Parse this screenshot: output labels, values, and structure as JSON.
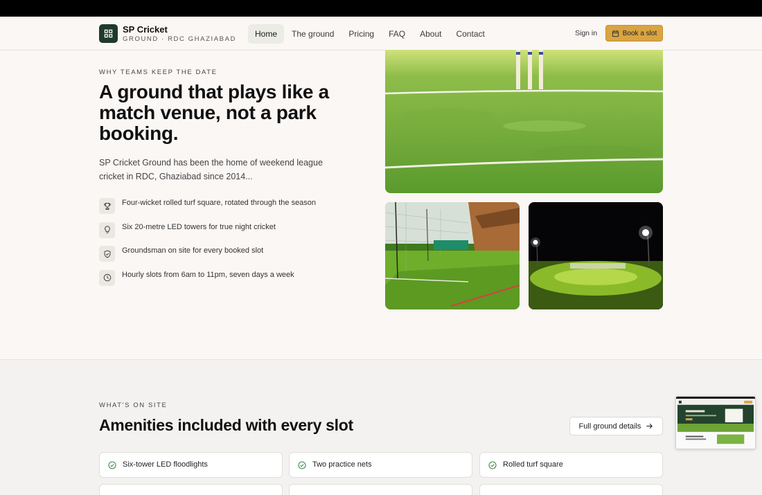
{
  "brand": {
    "name": "SP Cricket",
    "tagline": "GROUND · RDC GHAZIABAD"
  },
  "nav": {
    "links": [
      "Home",
      "The ground",
      "Pricing",
      "FAQ",
      "About",
      "Contact"
    ],
    "active": "Home",
    "signin": "Sign in",
    "book": "Book a slot"
  },
  "hero": {
    "eyebrow": "WHY TEAMS KEEP THE DATE",
    "title": "A ground that plays like a match venue, not a park booking.",
    "text": "SP Cricket Ground has been the home of weekend league cricket in RDC, Ghaziabad since 2014...",
    "features": [
      {
        "icon": "trophy-icon",
        "text": "Four-wicket rolled turf square, rotated through the season"
      },
      {
        "icon": "lightbulb-icon",
        "text": "Six 20-metre LED towers for true night cricket"
      },
      {
        "icon": "shield-icon",
        "text": "Groundsman on site for every booked slot"
      },
      {
        "icon": "clock-icon",
        "text": "Hourly slots from 6am to 11pm, seven days a week"
      }
    ]
  },
  "amenities": {
    "eyebrow": "WHAT'S ON SITE",
    "title": "Amenities included with every slot",
    "details_btn": "Full ground details",
    "items": [
      "Six-tower LED floodlights",
      "Two practice nets",
      "Rolled turf square"
    ]
  },
  "colors": {
    "accent": "#d9a441",
    "brand": "#1f3a2c",
    "check": "#3f8a4a"
  }
}
